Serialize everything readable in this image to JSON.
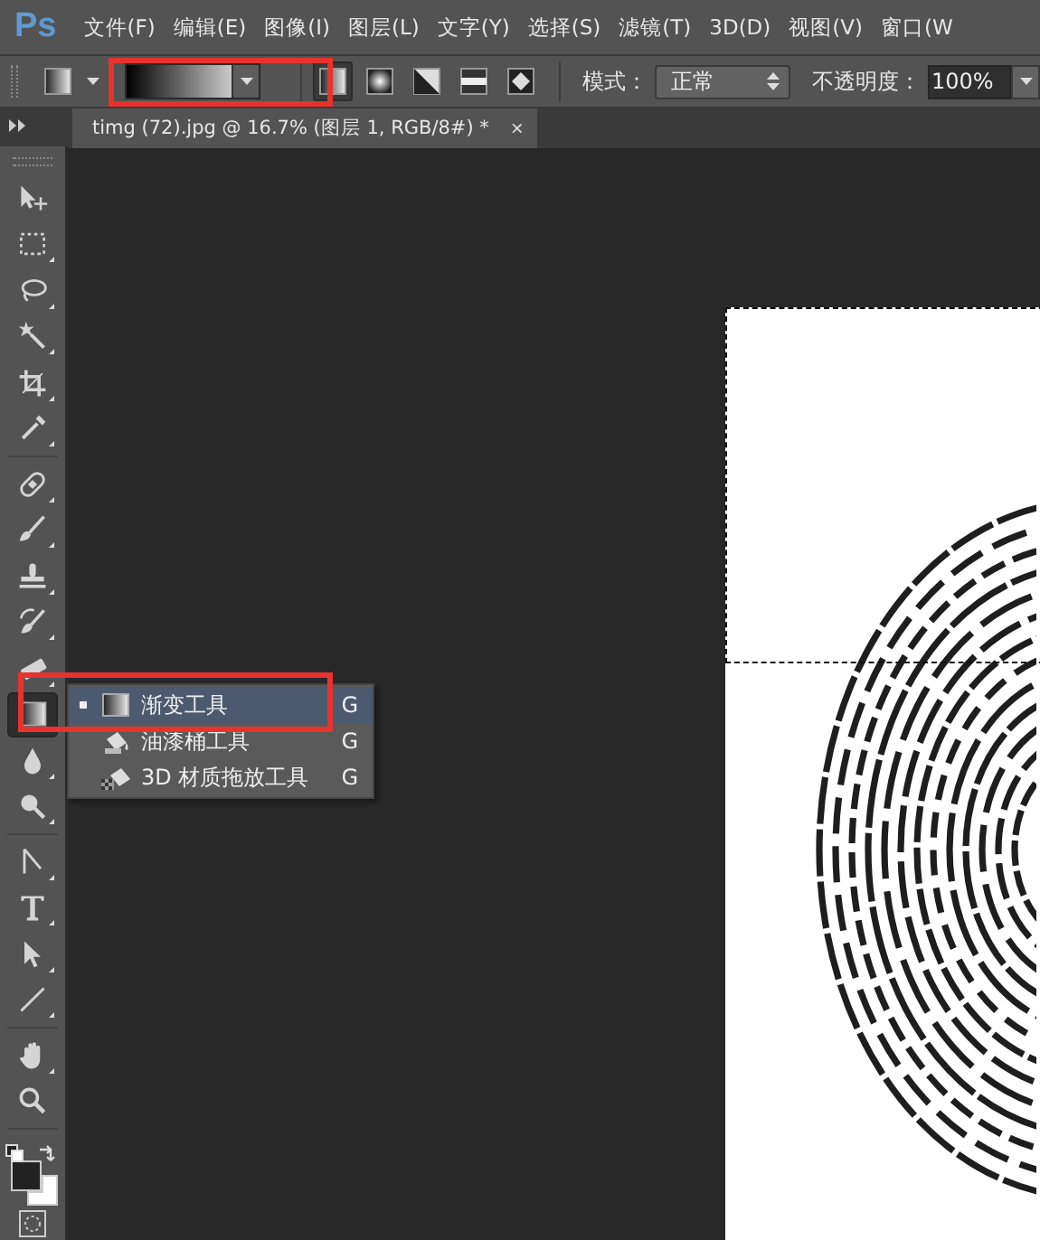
{
  "menu_bar": {
    "logo": "Ps",
    "items": [
      {
        "label": "文件(F)"
      },
      {
        "label": "编辑(E)"
      },
      {
        "label": "图像(I)"
      },
      {
        "label": "图层(L)"
      },
      {
        "label": "文字(Y)"
      },
      {
        "label": "选择(S)"
      },
      {
        "label": "滤镜(T)"
      },
      {
        "label": "3D(D)"
      },
      {
        "label": "视图(V)"
      },
      {
        "label": "窗口(W"
      }
    ]
  },
  "options_bar": {
    "gradient_types": [
      {
        "kind": "linear",
        "selected": true
      },
      {
        "kind": "radial",
        "selected": false
      },
      {
        "kind": "angle",
        "selected": false
      },
      {
        "kind": "reflected",
        "selected": false
      },
      {
        "kind": "diamond",
        "selected": false
      }
    ],
    "mode": {
      "label": "模式：",
      "value": "正常"
    },
    "opacity": {
      "label": "不透明度：",
      "value": "100%"
    }
  },
  "document_tab": {
    "title": "timg (72).jpg @ 16.7% (图层 1, RGB/8#) *",
    "close": "×"
  },
  "toolbar": {
    "groups": [
      {
        "tools": [
          {
            "kind": "move",
            "selected": false,
            "submenu": false
          },
          {
            "kind": "marquee",
            "selected": false,
            "submenu": true
          },
          {
            "kind": "lasso",
            "selected": false,
            "submenu": true
          },
          {
            "kind": "wand",
            "selected": false,
            "submenu": true
          },
          {
            "kind": "crop",
            "selected": false,
            "submenu": true
          },
          {
            "kind": "eyedropper",
            "selected": false,
            "submenu": true
          }
        ]
      },
      {
        "tools": [
          {
            "kind": "healing",
            "selected": false,
            "submenu": true
          },
          {
            "kind": "brush",
            "selected": false,
            "submenu": true
          },
          {
            "kind": "stamp",
            "selected": false,
            "submenu": true
          },
          {
            "kind": "history",
            "selected": false,
            "submenu": true
          },
          {
            "kind": "eraser",
            "selected": false,
            "submenu": true
          },
          {
            "kind": "gradient",
            "selected": true,
            "submenu": true
          },
          {
            "kind": "blur",
            "selected": false,
            "submenu": true
          },
          {
            "kind": "dodge",
            "selected": false,
            "submenu": true
          }
        ]
      },
      {
        "tools": [
          {
            "kind": "pen",
            "selected": false,
            "submenu": true
          },
          {
            "kind": "type",
            "selected": false,
            "submenu": true
          },
          {
            "kind": "select",
            "selected": false,
            "submenu": true
          },
          {
            "kind": "line",
            "selected": false,
            "submenu": true
          }
        ]
      },
      {
        "tools": [
          {
            "kind": "hand",
            "selected": false,
            "submenu": true
          },
          {
            "kind": "zoom",
            "selected": false,
            "submenu": false
          }
        ]
      }
    ]
  },
  "tool_flyout": {
    "items": [
      {
        "kind": "gradient",
        "label": "渐变工具",
        "shortcut": "G",
        "selected": true,
        "current": true
      },
      {
        "kind": "bucket",
        "label": "油漆桶工具",
        "shortcut": "G",
        "selected": false,
        "current": false
      },
      {
        "kind": "material",
        "label": "3D 材质拖放工具",
        "shortcut": "G",
        "selected": false,
        "current": false
      }
    ]
  }
}
